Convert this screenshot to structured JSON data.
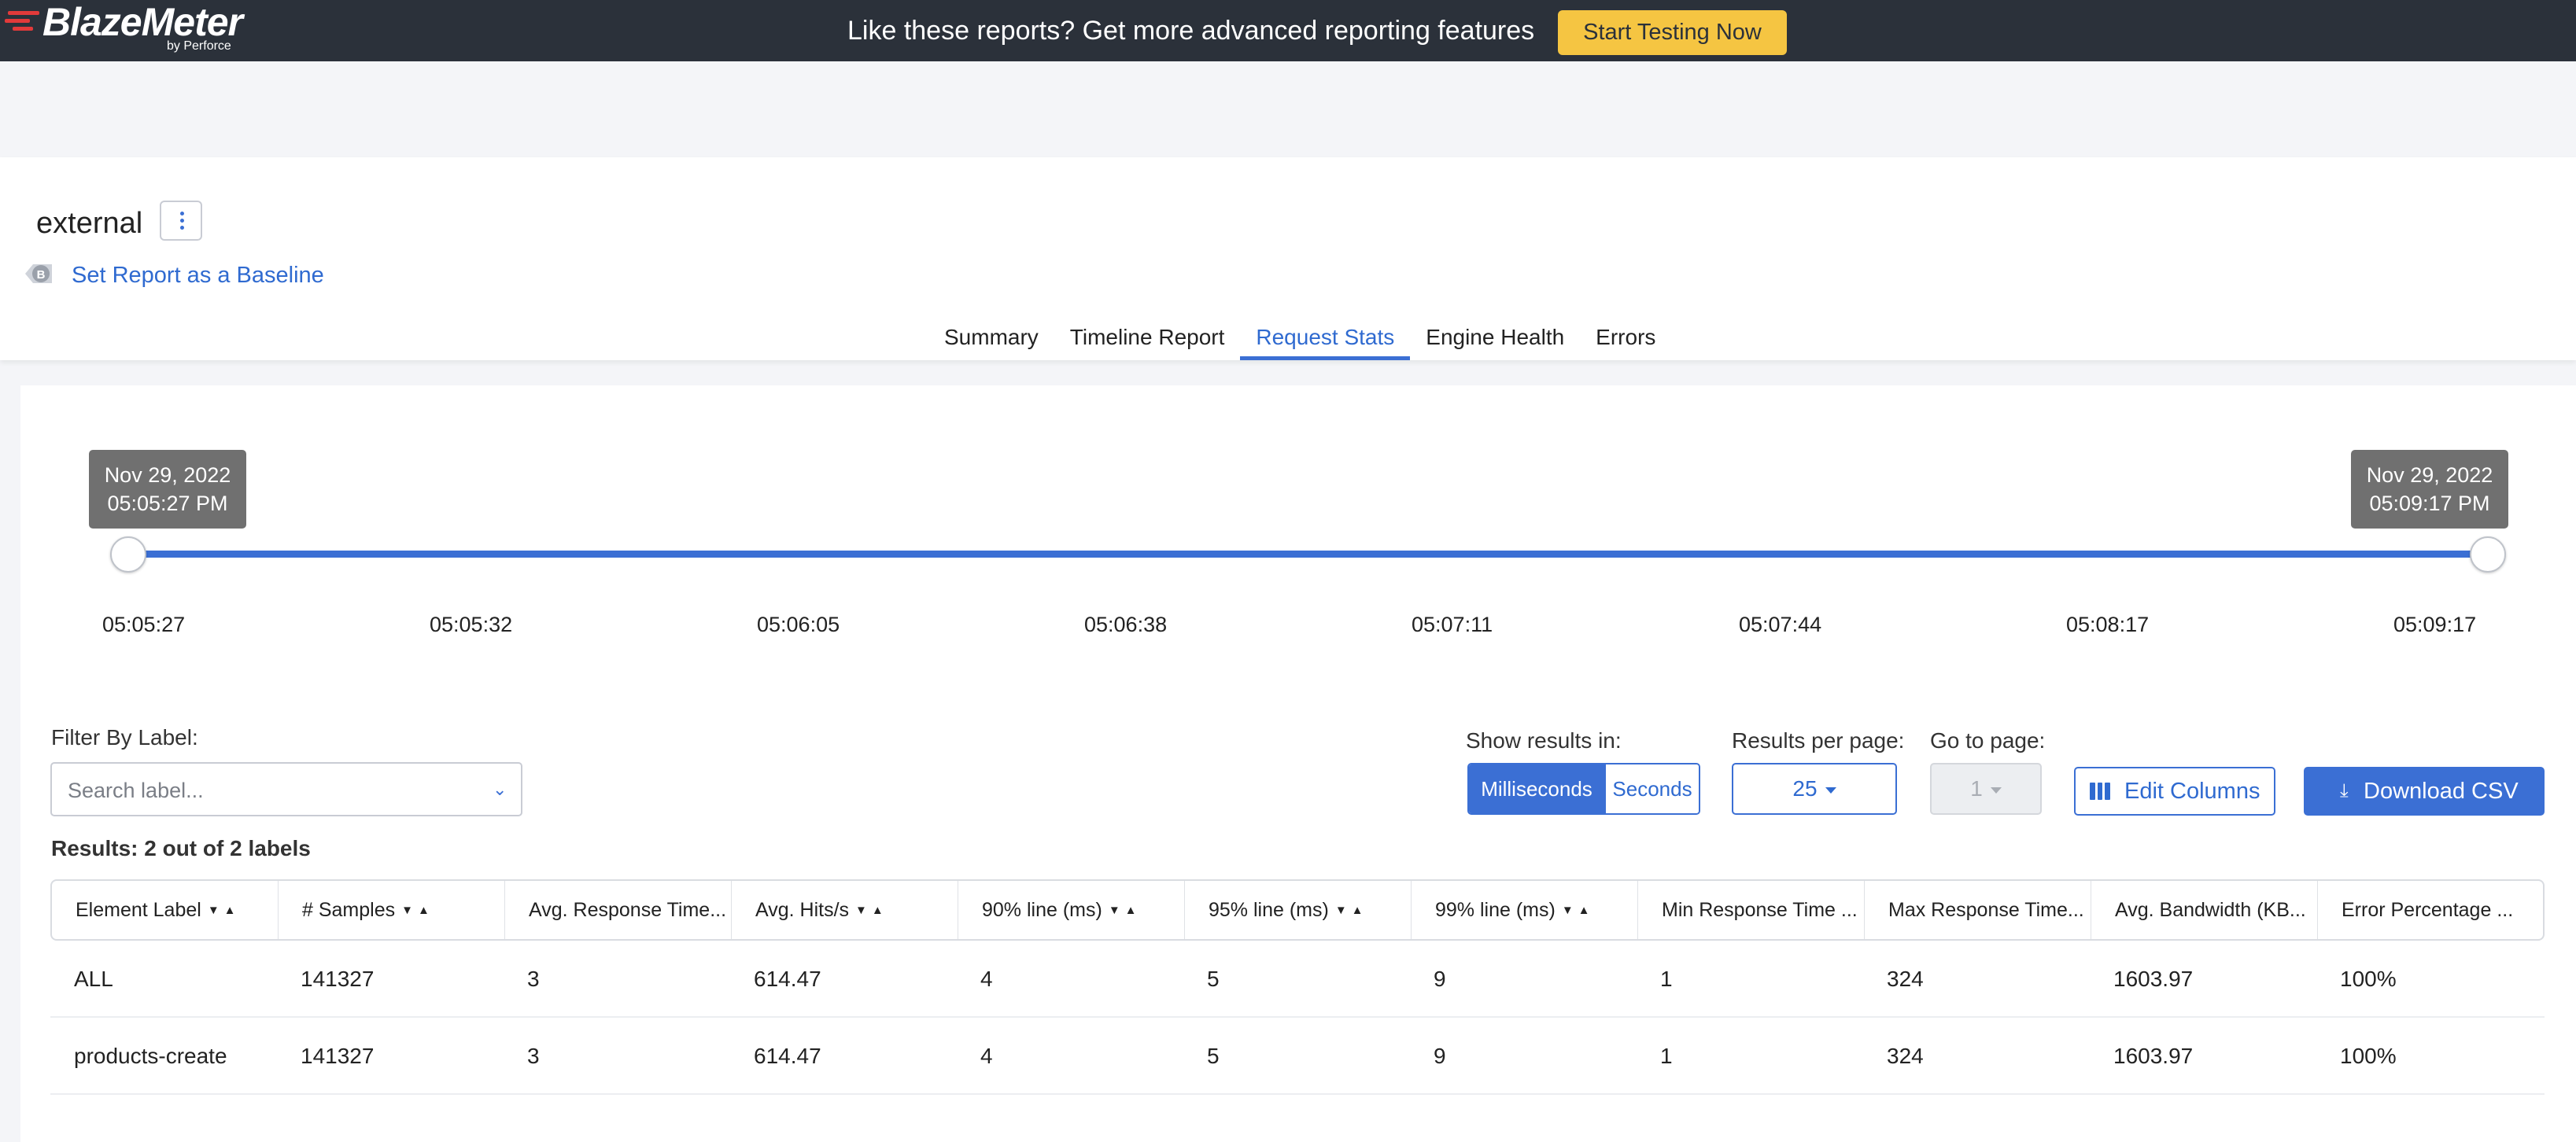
{
  "banner": {
    "logo_text": "BlazeMeter",
    "logo_sub": "by Perforce",
    "message": "Like these reports? Get more advanced reporting features",
    "cta_label": "Start Testing Now"
  },
  "report": {
    "title": "external",
    "baseline_link": "Set Report as a Baseline",
    "baseline_icon": "B"
  },
  "tabs": [
    "Summary",
    "Timeline Report",
    "Request Stats",
    "Engine Health",
    "Errors"
  ],
  "active_tab": "Request Stats",
  "timeline": {
    "start_date": "Nov 29, 2022",
    "start_time": "05:05:27 PM",
    "end_date": "Nov 29, 2022",
    "end_time": "05:09:17 PM",
    "ticks": [
      "05:05:27",
      "05:05:32",
      "05:06:05",
      "05:06:38",
      "05:07:11",
      "05:07:44",
      "05:08:17",
      "05:09:17"
    ]
  },
  "filter": {
    "label": "Filter By Label:",
    "placeholder": "Search label..."
  },
  "controls": {
    "show_results_label": "Show results in:",
    "unit_ms": "Milliseconds",
    "unit_s": "Seconds",
    "per_page_label": "Results per page:",
    "per_page_value": "25",
    "goto_label": "Go to page:",
    "goto_value": "1",
    "edit_columns": "Edit Columns",
    "download_csv": "Download CSV"
  },
  "results_text": "Results: 2 out of 2 labels",
  "table": {
    "columns": [
      {
        "label": "Element Label",
        "sort": true
      },
      {
        "label": "# Samples",
        "sort": true
      },
      {
        "label": "Avg. Response Time...",
        "sort": false
      },
      {
        "label": "Avg. Hits/s",
        "sort": true
      },
      {
        "label": "90% line (ms)",
        "sort": true
      },
      {
        "label": "95% line (ms)",
        "sort": true
      },
      {
        "label": "99% line (ms)",
        "sort": true
      },
      {
        "label": "Min Response Time ...",
        "sort": false
      },
      {
        "label": "Max Response Time...",
        "sort": false
      },
      {
        "label": "Avg. Bandwidth (KB...",
        "sort": false
      },
      {
        "label": "Error Percentage ...",
        "sort": false
      }
    ],
    "rows": [
      [
        "ALL",
        "141327",
        "3",
        "614.47",
        "4",
        "5",
        "9",
        "1",
        "324",
        "1603.97",
        "100%"
      ],
      [
        "products-create",
        "141327",
        "3",
        "614.47",
        "4",
        "5",
        "9",
        "1",
        "324",
        "1603.97",
        "100%"
      ]
    ]
  },
  "colors": {
    "accent": "#3b6fd4",
    "banner_bg": "#2b313a",
    "cta_bg": "#f5c542",
    "tooltip_bg": "#707070"
  },
  "icons": [
    "kebab-menu-icon",
    "baseline-icon",
    "chevron-down-icon",
    "columns-icon",
    "download-icon",
    "sort-arrows-icon"
  ]
}
